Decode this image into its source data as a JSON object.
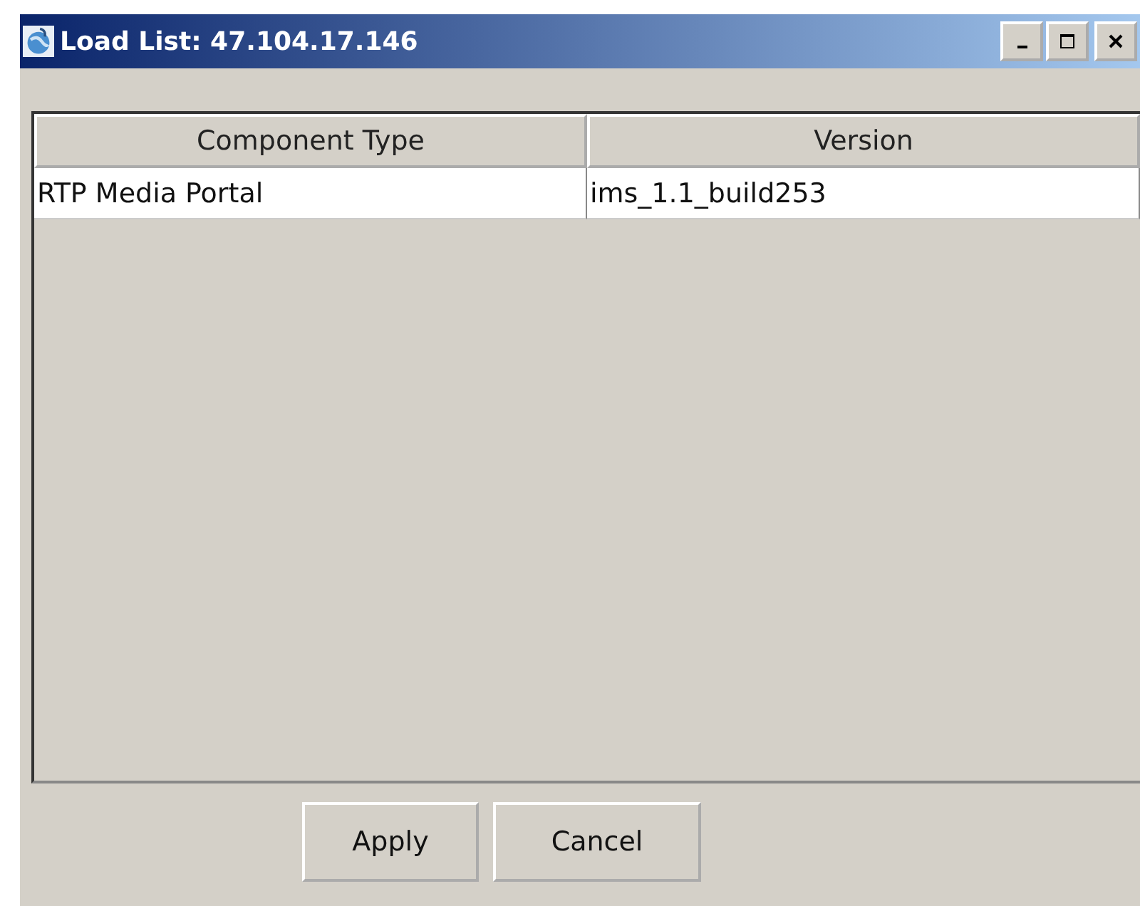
{
  "window": {
    "title": "Load List: 47.104.17.146"
  },
  "table": {
    "columns": [
      "Component Type",
      "Version"
    ],
    "rows": [
      [
        "RTP Media Portal",
        "ims_1.1_build253"
      ]
    ]
  },
  "buttons": [
    "Apply",
    "Cancel"
  ]
}
